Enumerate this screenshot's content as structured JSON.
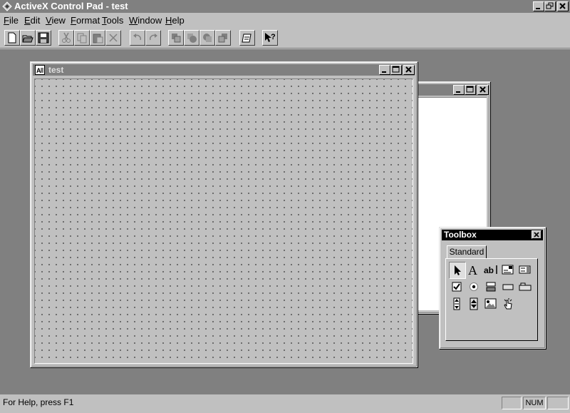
{
  "app": {
    "title": "ActiveX Control Pad - test"
  },
  "menu": [
    {
      "label": "File",
      "accel": "F",
      "rest": "ile"
    },
    {
      "label": "Edit",
      "accel": "E",
      "rest": "dit"
    },
    {
      "label": "View",
      "accel": "V",
      "rest": "iew"
    },
    {
      "label": "Format",
      "accel": "F",
      "rest": "ormat"
    },
    {
      "label": "Tools",
      "accel": "T",
      "rest": "ools"
    },
    {
      "label": "Window",
      "accel": "W",
      "rest": "indow"
    },
    {
      "label": "Help",
      "accel": "H",
      "rest": "elp"
    }
  ],
  "toolbar": {
    "icons": [
      "new-file-icon",
      "open-folder-icon",
      "save-icon",
      "cut-icon",
      "copy-icon",
      "paste-icon",
      "delete-icon",
      "undo-icon",
      "redo-icon",
      "bring-to-front-icon",
      "bring-forward-icon",
      "send-backward-icon",
      "send-to-back-icon",
      "script-wizard-icon",
      "context-help-icon"
    ]
  },
  "windows": {
    "test": {
      "title": "test"
    }
  },
  "toolbox": {
    "title": "Toolbox",
    "tab": "Standard",
    "tools": [
      "pointer-tool-icon",
      "label-tool-icon",
      "textbox-tool-icon",
      "combobox-tool-icon",
      "listbox-tool-icon",
      "checkbox-tool-icon",
      "optionbutton-tool-icon",
      "togglebutton-tool-icon",
      "commandbutton-tool-icon",
      "tabstrip-tool-icon",
      "scrollbar-tool-icon",
      "spinbutton-tool-icon",
      "image-tool-icon",
      "hotspot-tool-icon"
    ]
  },
  "status": {
    "help_text": "For Help, press F1",
    "num": "NUM"
  },
  "colors": {
    "desktop": "#808080",
    "face": "#c0c0c0",
    "active_title": "#000000",
    "inactive_title": "#808080"
  }
}
